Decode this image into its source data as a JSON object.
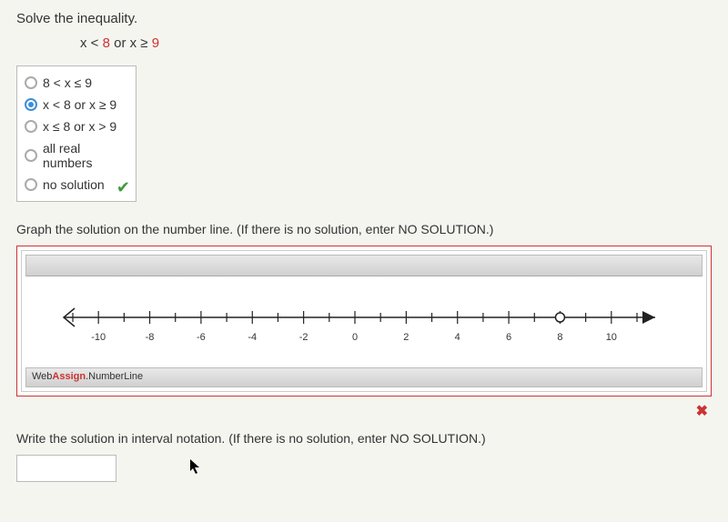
{
  "question_title": "Solve the inequality.",
  "inequality": {
    "part1": "x < ",
    "num1": "8",
    "mid": " or x ≥ ",
    "num2": "9"
  },
  "options": [
    {
      "label": "8 < x ≤ 9",
      "selected": false
    },
    {
      "label": "x < 8 or x ≥ 9",
      "selected": true
    },
    {
      "label": "x ≤ 8 or x > 9",
      "selected": false
    },
    {
      "label": "all real numbers",
      "selected": false
    },
    {
      "label": "no solution",
      "selected": false
    }
  ],
  "check": "✔",
  "graph_instruction": "Graph the solution on the number line. (If there is no solution, enter NO SOLUTION.)",
  "numberline": {
    "ticks": [
      -10,
      -8,
      -6,
      -4,
      -2,
      0,
      2,
      4,
      6,
      8,
      10
    ],
    "min": -11,
    "max": 11,
    "open_point_at": 8
  },
  "brand": {
    "web": "Web",
    "assign": "Assign",
    "rest": ".NumberLine"
  },
  "x_mark": "✖",
  "interval_instruction": "Write the solution in interval notation. (If there is no solution, enter NO SOLUTION.)",
  "answer_value": ""
}
